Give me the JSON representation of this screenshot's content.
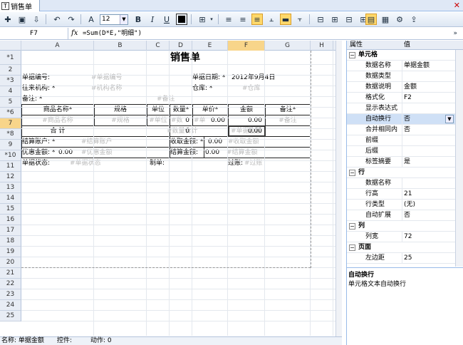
{
  "window": {
    "tab_title": "销售单",
    "tab_icon": "T"
  },
  "toolbar": {
    "font_size": "12",
    "buttons": [
      "new",
      "save",
      "saveas",
      "undo",
      "redo",
      "font",
      "bold",
      "italic",
      "underline",
      "fontcolor",
      "border",
      "align-left",
      "align-center",
      "align-right",
      "valign-top",
      "valign-middle",
      "valign-bottom",
      "insert-row",
      "insert-col",
      "delete-row",
      "delete-col",
      "preview",
      "print",
      "settings",
      "export"
    ],
    "bold_label": "B",
    "italic_label": "I",
    "underline_label": "U"
  },
  "formula_bar": {
    "cell_ref": "F7",
    "fx": "fx",
    "formula": "=Sum(D*E,\"明细\")",
    "expand": "»"
  },
  "sheet": {
    "columns": [
      "A",
      "B",
      "C",
      "D",
      "E",
      "F",
      "G",
      "H"
    ],
    "selected_column": "F",
    "rows": [
      "*1",
      "2",
      "*3",
      "4",
      "5",
      "*6",
      "7",
      "*8",
      "9",
      "*10",
      "11",
      "12",
      "13",
      "14",
      "15",
      "16",
      "17",
      "18",
      "19",
      "20",
      "21",
      "22",
      "23",
      "24",
      "25"
    ],
    "selected_row": "7",
    "title": "销售单",
    "r2": {
      "label": "单据编号:",
      "ph": "#单据编号",
      "date_label": "单据日期: *",
      "date_value": "2012年9月4日"
    },
    "r3": {
      "label": "往来机构: *",
      "ph": "#机构名称",
      "wh_label": "仓库: *",
      "wh_ph": "#仓库"
    },
    "r4": {
      "label": "备注: *",
      "ph": "#备注"
    },
    "r5": {
      "h1": "商品名称*",
      "h2": "规格",
      "h3": "单位",
      "h4": "数量*",
      "h5": "单价*",
      "h6": "金额",
      "h7": "备注*"
    },
    "r6": {
      "c1": "#商品名称",
      "c2": "#规格",
      "c3": "#单位",
      "c4": "0",
      "c4ph": "#数",
      "c5": "0.00",
      "c5ph": "#单",
      "c6": "0.00",
      "c7": "#备注"
    },
    "r7": {
      "label": "合 计",
      "qty": "0",
      "qty_ph": "#数量合计",
      "amt": "0.00",
      "amt_ph": "#单据金额"
    },
    "r8": {
      "label": "结算账户: *",
      "ph": "#结算账户",
      "recv_label": "收取金额: *",
      "recv_value": "0.00",
      "recv_ph": "#收取金额"
    },
    "r9": {
      "label": "优惠金额: *",
      "value": "0.00",
      "ph": "#优惠金额",
      "settle_label": "结算金额:",
      "settle_value": "0.00",
      "settle_ph": "#结算金额"
    },
    "r10": {
      "status_label": "单据状态:",
      "status_ph": "#单据状态",
      "maker_label": "制单:",
      "transfer_label": "过账:",
      "transfer_ph": "#过账"
    }
  },
  "status_bar": {
    "name": "名称: 单据金额",
    "control": "控件:",
    "action": "动作: 0"
  },
  "properties": {
    "header_key": "属性",
    "header_val": "值",
    "items": [
      {
        "type": "cat",
        "key": "单元格",
        "toggle": "−"
      },
      {
        "key": "数据名称",
        "val": "单据金额"
      },
      {
        "key": "数据类型",
        "val": ""
      },
      {
        "key": "数据说明",
        "val": "金额"
      },
      {
        "key": "格式化",
        "val": "F2"
      },
      {
        "key": "显示表达式",
        "val": ""
      },
      {
        "key": "自动换行",
        "val": "否",
        "selected": true
      },
      {
        "key": "合并相同内",
        "val": "否"
      },
      {
        "key": "前缀",
        "val": ""
      },
      {
        "key": "后缀",
        "val": ""
      },
      {
        "key": "标签摘要",
        "val": "是"
      },
      {
        "type": "cat",
        "key": "行",
        "toggle": "−"
      },
      {
        "key": "数据名称",
        "val": ""
      },
      {
        "key": "行高",
        "val": "21"
      },
      {
        "key": "行类型",
        "val": "(无)"
      },
      {
        "key": "自动扩展",
        "val": "否"
      },
      {
        "type": "cat",
        "key": "列",
        "toggle": "−"
      },
      {
        "key": "列宽",
        "val": "72"
      },
      {
        "type": "cat",
        "key": "页面",
        "toggle": "−"
      },
      {
        "key": "左边距",
        "val": "25"
      }
    ],
    "desc_title": "自动换行",
    "desc_text": "单元格文本自动换行"
  },
  "colors": {
    "accent": "#ffd86b",
    "selection": "#f8d58a",
    "panel_border": "#99bbe8"
  }
}
